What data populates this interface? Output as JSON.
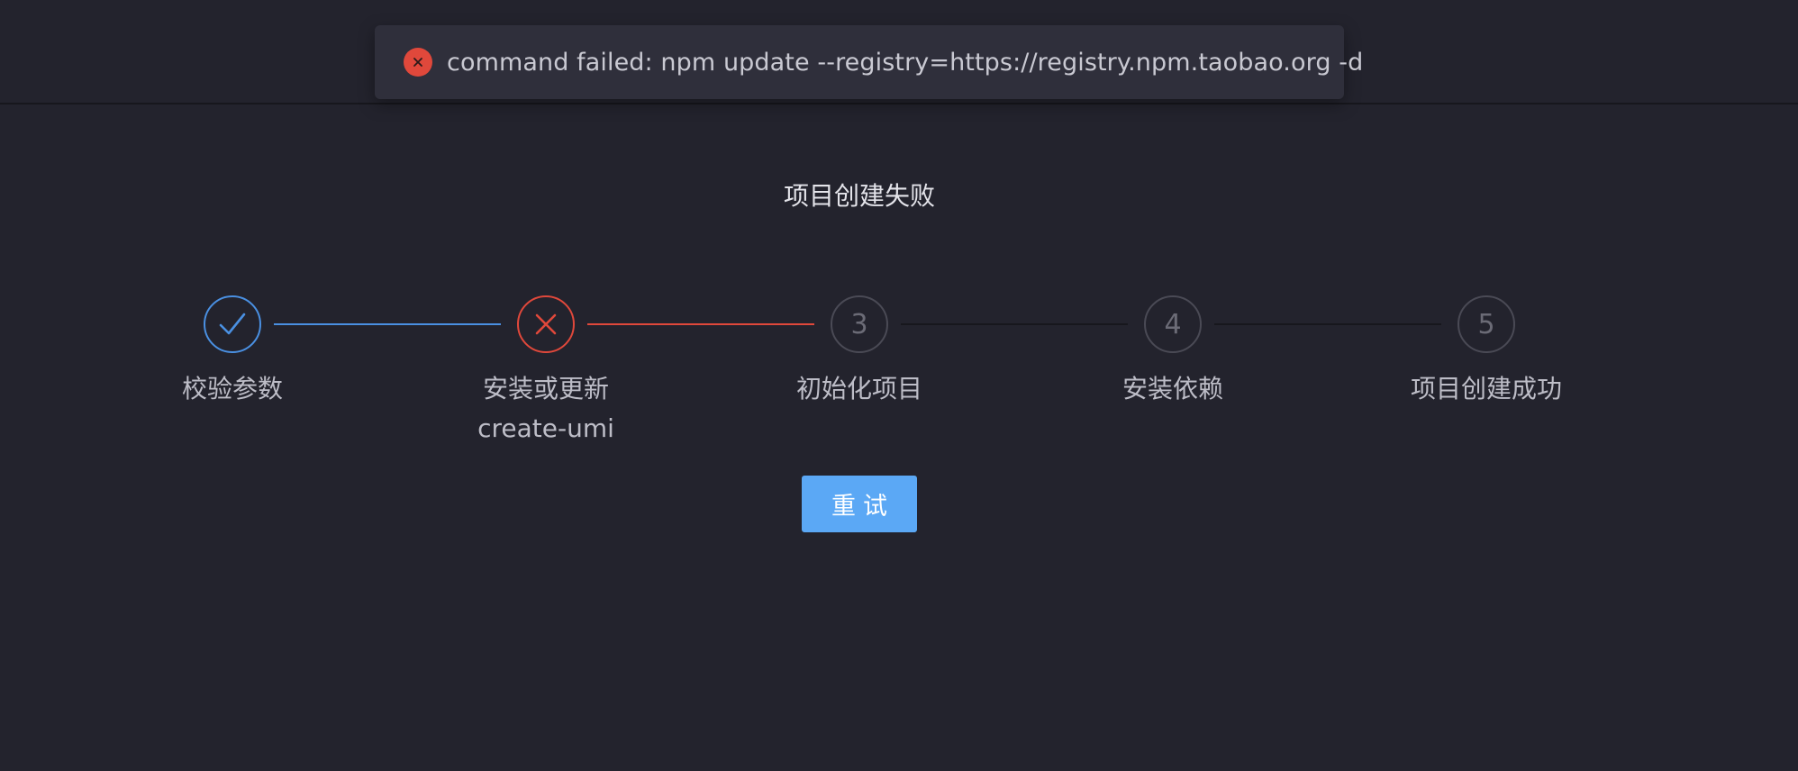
{
  "toast": {
    "icon": "close-circle-icon",
    "message": "command failed: npm update --registry=https://registry.npm.taobao.org -d"
  },
  "page_title": "项目创建失败",
  "steps": [
    {
      "status": "done",
      "icon": "check-icon",
      "number": "1",
      "label": "校验参数"
    },
    {
      "status": "error",
      "icon": "close-icon",
      "number": "2",
      "label": "安装或更新 create-umi"
    },
    {
      "status": "wait",
      "icon": "",
      "number": "3",
      "label": "初始化项目"
    },
    {
      "status": "wait",
      "icon": "",
      "number": "4",
      "label": "安装依赖"
    },
    {
      "status": "wait",
      "icon": "",
      "number": "5",
      "label": "项目创建成功"
    }
  ],
  "retry_button": {
    "label": "重试"
  },
  "colors": {
    "background": "#23232d",
    "toast_background": "#2f2f3b",
    "done": "#4a90e2",
    "error": "#e0483b",
    "wait": "#4a4a55",
    "primary_button": "#5ba8f5"
  }
}
